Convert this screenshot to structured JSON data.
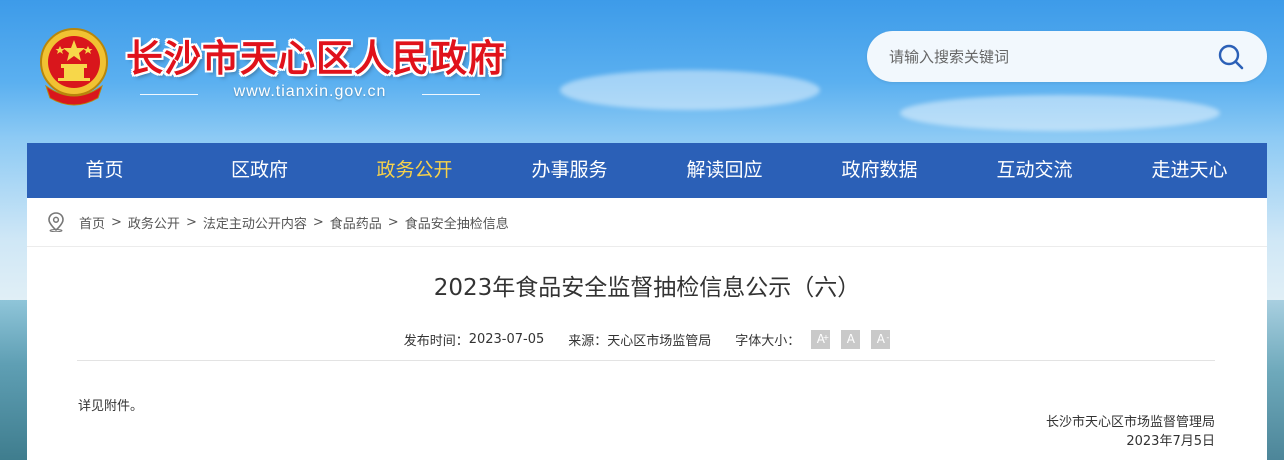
{
  "header": {
    "site_title": "长沙市天心区人民政府",
    "site_url": "www.tianxin.gov.cn",
    "emblem_icon": "national-emblem-icon"
  },
  "search": {
    "placeholder": "请输入搜索关键词",
    "icon": "search-icon"
  },
  "nav": {
    "items": [
      {
        "label": "首页"
      },
      {
        "label": "区政府"
      },
      {
        "label": "政务公开",
        "active": true
      },
      {
        "label": "办事服务"
      },
      {
        "label": "解读回应"
      },
      {
        "label": "政府数据"
      },
      {
        "label": "互动交流"
      },
      {
        "label": "走进天心"
      }
    ]
  },
  "breadcrumb": {
    "icon": "location-pin-icon",
    "items": [
      "首页",
      "政务公开",
      "法定主动公开内容",
      "食品药品",
      "食品安全抽检信息"
    ],
    "separator": ">"
  },
  "article": {
    "title": "2023年食品安全监督抽检信息公示（六）",
    "publish_label": "发布时间：",
    "publish_date": "2023-07-05",
    "source_label": "来源：",
    "source": "天心区市场监管局",
    "font_size_label": "字体大小：",
    "font_buttons": [
      "A",
      "A",
      "A"
    ],
    "body": "详见附件。",
    "signature_org": "长沙市天心区市场监督管理局",
    "signature_date": "2023年7月5日"
  },
  "colors": {
    "nav_bg": "#2b60b7",
    "nav_active": "#f8d24a",
    "title_red": "#e0121b"
  }
}
